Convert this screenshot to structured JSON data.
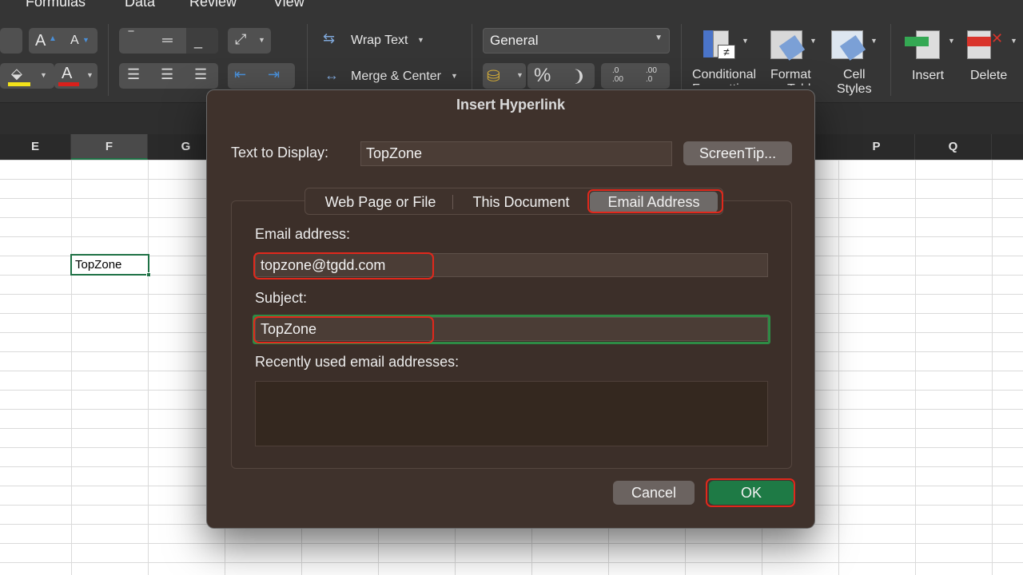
{
  "ribbon": {
    "menu_tabs": [
      "Formulas",
      "Data",
      "Review",
      "View"
    ],
    "wrap_text": "Wrap Text",
    "merge_center": "Merge & Center",
    "number_format": "General",
    "percent": "%",
    "comma": "❩",
    "inc_decimal": ".0\n.00",
    "dec_decimal": ".00\n.0",
    "conditional_formatting": "Conditional\nFormatting",
    "format_as_table": "Format\nas Table",
    "cell_styles": "Cell\nStyles",
    "insert": "Insert",
    "delete": "Delete",
    "font_increase": "A",
    "font_decrease": "A",
    "font_color": "A"
  },
  "sheet": {
    "columns_left": [
      "E",
      "F",
      "G"
    ],
    "columns_right": [
      "P",
      "Q"
    ],
    "selected_cell_value": "TopZone"
  },
  "dialog": {
    "title": "Insert Hyperlink",
    "text_to_display_label": "Text to Display:",
    "text_to_display_value": "TopZone",
    "screentip_button": "ScreenTip...",
    "tabs": [
      "Web Page or File",
      "This Document",
      "Email Address"
    ],
    "active_tab": "Email Address",
    "email_label": "Email address:",
    "email_value": "topzone@tgdd.com",
    "subject_label": "Subject:",
    "subject_value": "TopZone",
    "recent_label": "Recently used email addresses:",
    "cancel_button": "Cancel",
    "ok_button": "OK"
  },
  "colors": {
    "dialog_bg": "#3f322c",
    "ok_green": "#1e7a45",
    "highlight_red": "#e0281c",
    "focus_green": "#2e8b45"
  }
}
